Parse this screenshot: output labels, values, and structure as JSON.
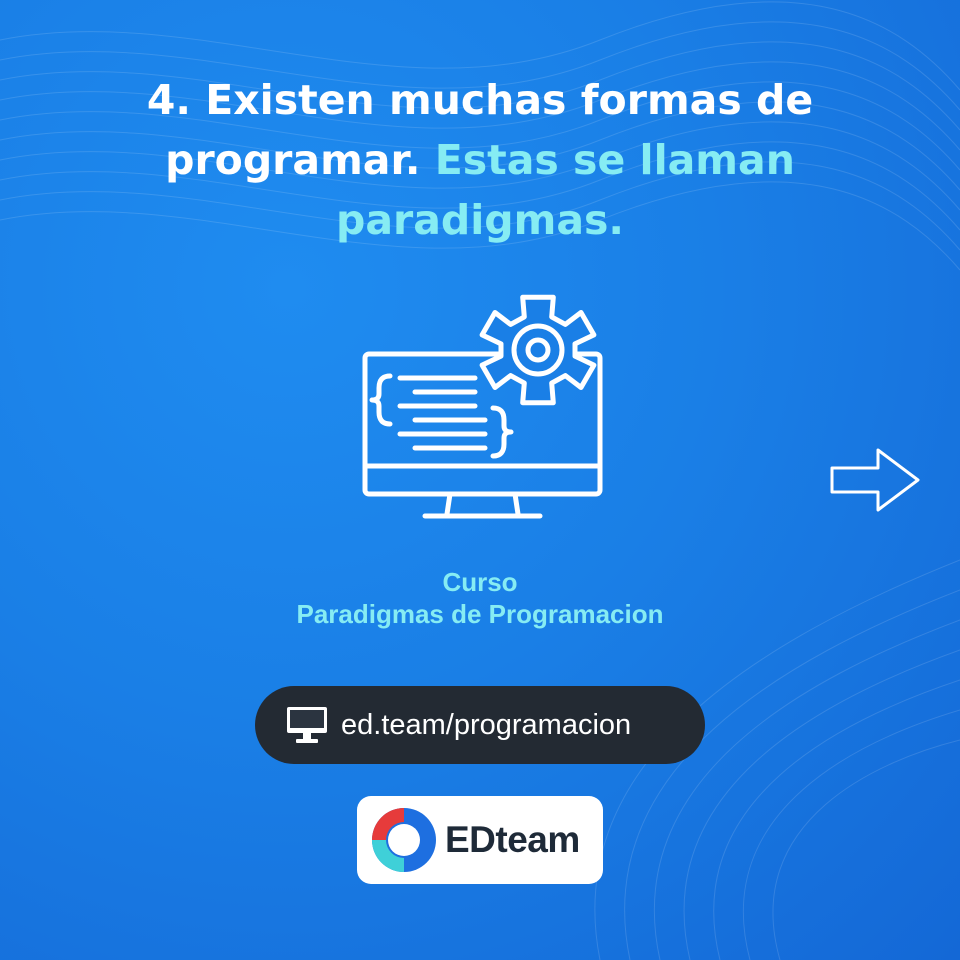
{
  "headline": {
    "lead": "4. Existen muchas formas de programar.",
    "highlight": "Estas se llaman paradigmas."
  },
  "illustration": {
    "icon": "monitor-code-gear-icon"
  },
  "course": {
    "label": "Curso",
    "title": "Paradigmas de Programacion"
  },
  "link": {
    "icon": "monitor-icon",
    "url": "ed.team/programacion"
  },
  "logo": {
    "brand": "EDteam",
    "colors": {
      "red": "#e63b3b",
      "blue": "#1e6fe0",
      "teal": "#3fd0d8"
    }
  },
  "navigation": {
    "next": "arrow-right-icon"
  },
  "colors": {
    "background": "#1a7fe6",
    "headline": "#ffffff",
    "accent": "#86ecf3",
    "pill": "#232a33"
  }
}
